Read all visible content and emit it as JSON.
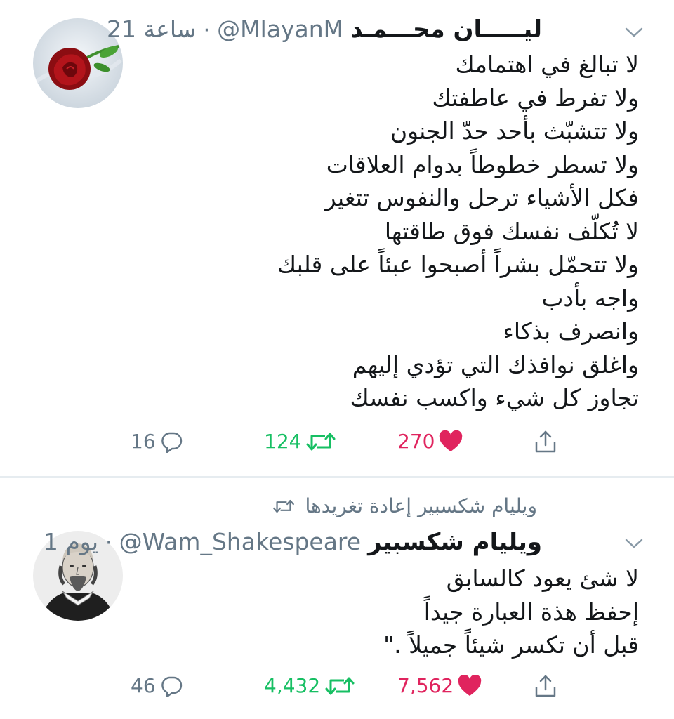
{
  "tweets": [
    {
      "display_name": "ليـــــان محـــمـد",
      "handle": "@MlayanM",
      "time": "21 ساعة",
      "lines": [
        "لا تبالغ في اهتمامك",
        "ولا تفرط في عاطفتك",
        "ولا تتشبّث بأحد حدّ الجنون",
        "ولا تسطر خطوطاً بدوام العلاقات",
        "فكل الأشياء ترحل والنفوس تتغير",
        "لا تُكلّف نفسك فوق طاقتها",
        "ولا تتحمّل بشراً أصبحوا عبئاً على قلبك",
        "واجه بأدب",
        "وانصرف بذكاء",
        "واغلق نوافذك التي تؤدي إليهم",
        "تجاوز كل شيء واكسب نفسك"
      ],
      "replies": "16",
      "retweets": "124",
      "likes": "270",
      "avatar_icon": "red-rose-avatar"
    },
    {
      "retweet_context": "ويليام شكسبير إعادة تغريدها",
      "display_name": "ويليام شكسبير",
      "handle": "@Wam_Shakespeare",
      "time": "1 يوم",
      "lines": [
        "لا شئ يعود كالسابق",
        "إحفظ هذة العبارة جيداً",
        "قبل أن تكسر شيئاً جميلاً .\""
      ],
      "replies": "46",
      "retweets": "4,432",
      "likes": "7,562",
      "avatar_icon": "shakespeare-portrait-avatar"
    }
  ],
  "colors": {
    "text": "#14171a",
    "muted": "#657786",
    "retweet_green": "#17bf63",
    "like_red": "#e0245e",
    "divider": "#e6ecf0"
  },
  "icons": [
    "chevron-down-icon",
    "reply-icon",
    "retweet-icon",
    "heart-icon",
    "share-icon"
  ]
}
